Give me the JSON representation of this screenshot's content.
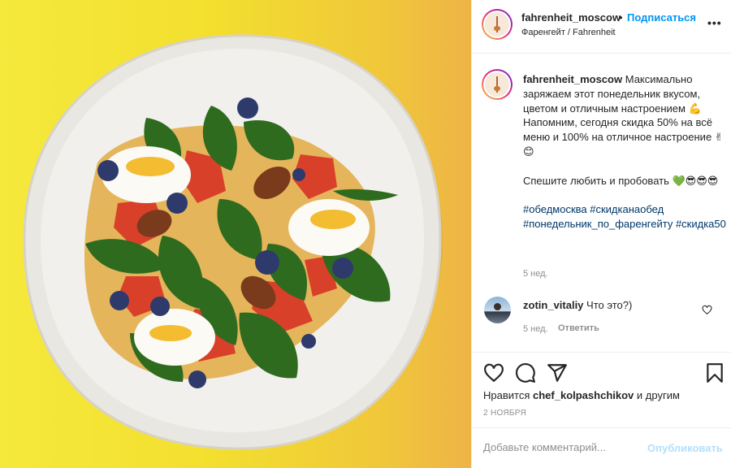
{
  "post": {
    "username": "fahrenheit_moscow",
    "follow_separator": "•",
    "follow_label": "Подписаться",
    "location": "Фаренгейт / Fahrenheit",
    "more_label": "•••"
  },
  "caption": {
    "username": "fahrenheit_moscow",
    "paragraph1": "Максимально заряжаем этот понедельник вкусом, цветом и отличным настроением 💪 Напомним, сегодня скидка 50% на всё меню и 100% на отличное настроение ✌😊",
    "paragraph2": "Спешите любить и пробовать 💚😎😎😎",
    "hashtags": "#обедмосква #скидканаобед #понедельник_по_фаренгейту #скидка50",
    "time": "5 нед."
  },
  "comment": {
    "username": "zotin_vitaliy",
    "text": "Что это?)",
    "time": "5 нед.",
    "reply_label": "Ответить"
  },
  "actions": {
    "likes_prefix": "Нравится",
    "likes_user": "chef_kolpashchikov",
    "likes_suffix": "и другим",
    "date": "2 НОЯБРЯ"
  },
  "comment_bar": {
    "placeholder": "Добавьте комментарий...",
    "publish_label": "Опубликовать"
  },
  "colors": {
    "accent": "#0095f6",
    "background_yellow": "#f5e93c",
    "background_orange": "#eeb446",
    "publish_disabled": "#b2dffc"
  }
}
